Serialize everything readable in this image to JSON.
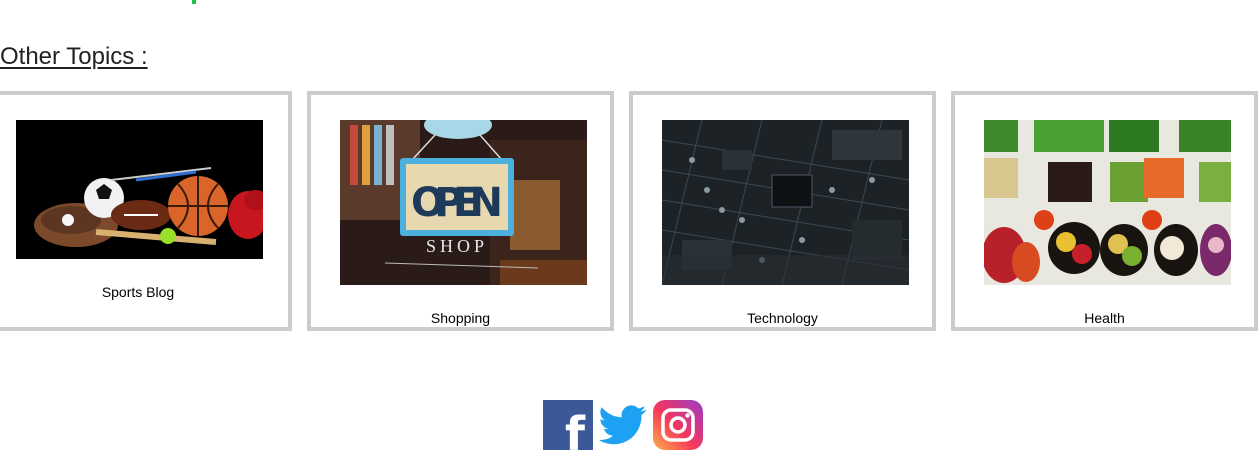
{
  "section": {
    "title": "Other Topics :"
  },
  "topics": [
    {
      "label": "Sports Blog"
    },
    {
      "label": "Shopping",
      "sign_word": "OPEN",
      "sign_sub": "SHOP"
    },
    {
      "label": "Technology"
    },
    {
      "label": "Health"
    }
  ],
  "social": {
    "facebook_glyph": "f"
  },
  "colors": {
    "accent_green": "#22c24a",
    "card_border": "#cccccc",
    "facebook": "#3b5998",
    "twitter": "#1da1f2"
  }
}
